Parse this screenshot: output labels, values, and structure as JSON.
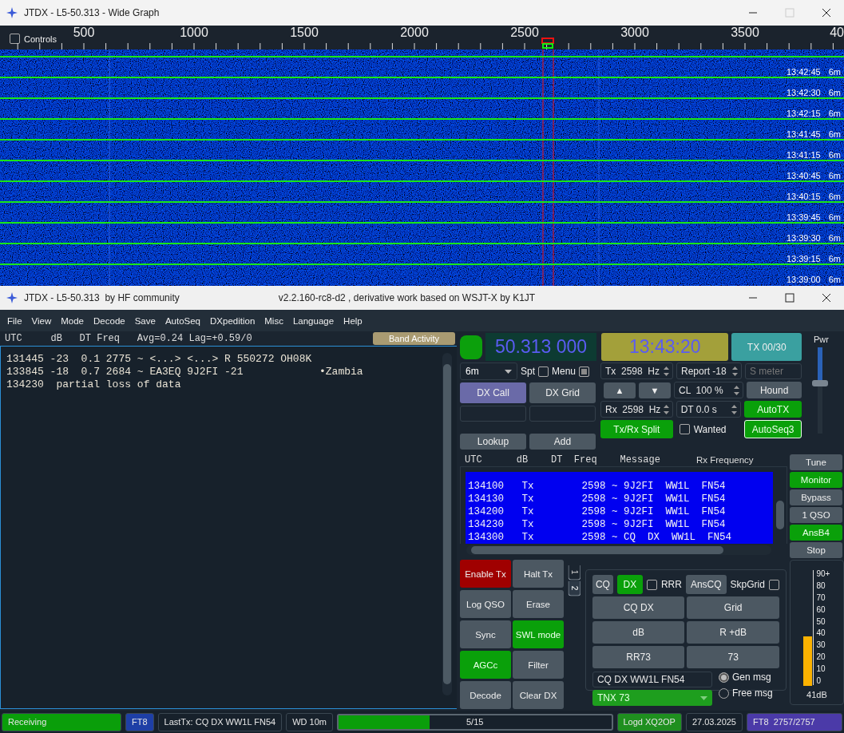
{
  "wide_graph": {
    "title": "JTDX - L5-50.313 - Wide Graph",
    "controls": {
      "label": "Controls",
      "checked": false
    },
    "scale_labels": [
      "500",
      "1000",
      "1500",
      "2000",
      "2500",
      "3000",
      "3500",
      "40"
    ],
    "waterfall_rows": [
      {
        "time": "13:42:45",
        "band": "6m"
      },
      {
        "time": "13:42:30",
        "band": "6m"
      },
      {
        "time": "13:42:15",
        "band": "6m"
      },
      {
        "time": "13:41:45",
        "band": "6m"
      },
      {
        "time": "13:41:15",
        "band": "6m"
      },
      {
        "time": "13:40:45",
        "band": "6m"
      },
      {
        "time": "13:40:15",
        "band": "6m"
      },
      {
        "time": "13:39:45",
        "band": "6m"
      },
      {
        "time": "13:39:30",
        "band": "6m"
      },
      {
        "time": "13:39:15",
        "band": "6m"
      },
      {
        "time": "13:39:00",
        "band": "6m"
      }
    ]
  },
  "main_window": {
    "title": "JTDX - L5-50.313  by HF community",
    "subtitle": "v2.2.160-rc8-d2 , derivative work based on WSJT-X by K1JT"
  },
  "menu": [
    "File",
    "View",
    "Mode",
    "Decode",
    "Save",
    "AutoSeq",
    "DXpedition",
    "Misc",
    "Language",
    "Help"
  ],
  "band_activity": {
    "header": "UTC     dB   DT Freq   Avg=0.24 Lag=+0.59/0",
    "button": "Band Activity",
    "lines": [
      {
        "text": "131445 -23  0.1 2775 ~ <...> <...> R 550272 OH08K"
      },
      {
        "text": "133845 -18  0.7 2684 ~ EA3EQ 9J2FI -21",
        "note": "•Zambia"
      },
      {
        "text": "134230  partial loss of data"
      }
    ]
  },
  "dial": {
    "led_on": true,
    "frequency": "50.313 000",
    "time": "13:43:20",
    "tx_counter": "TX 00/30",
    "band": "6m",
    "power_label": "Pwr",
    "power": {
      "level": 0.6
    }
  },
  "options": [
    {
      "label": "Spt",
      "checked": false
    },
    {
      "label": "Menu",
      "checked": true
    }
  ],
  "dx_buttons": [
    {
      "label": "DX Call",
      "selected": true
    },
    {
      "label": "DX Grid",
      "selected": false
    }
  ],
  "lookup_buttons": [
    "Lookup",
    "Add"
  ],
  "spin_boxes": [
    {
      "text": "Tx  2598  Hz"
    },
    {
      "text": "Report -18"
    },
    {
      "text": "CL  100 %"
    },
    {
      "text": "Rx  2598  Hz"
    },
    {
      "text": "DT 0.0 s"
    }
  ],
  "arrow_buttons": [
    "▲",
    "▼"
  ],
  "s_meter": {
    "placeholder": "S meter"
  },
  "split_button": {
    "label": "Tx/Rx Split",
    "on": true
  },
  "wanted": {
    "label": "Wanted",
    "checked": false
  },
  "auto_buttons": [
    {
      "label": "Hound",
      "on": false
    },
    {
      "label": "AutoTX",
      "on": true
    },
    {
      "label": "AutoSeq3",
      "on": true
    }
  ],
  "rx_frequency": {
    "header": "UTC      dB    DT  Freq    Message",
    "title": "Rx Frequency",
    "rows": [
      "134100   Tx        2598 ~ 9J2FI  WW1L  FN54",
      "134130   Tx        2598 ~ 9J2FI  WW1L  FN54",
      "134200   Tx        2598 ~ 9J2FI  WW1L  FN54",
      "134230   Tx        2598 ~ 9J2FI  WW1L  FN54",
      "134300   Tx        2598 ~ CQ  DX  WW1L  FN54"
    ]
  },
  "side_buttons": [
    {
      "label": "Tune",
      "on": false
    },
    {
      "label": "Monitor",
      "on": true
    },
    {
      "label": "Bypass",
      "on": false
    },
    {
      "label": "1 QSO",
      "on": false
    },
    {
      "label": "AnsB4",
      "on": true
    },
    {
      "label": "Stop",
      "on": false
    }
  ],
  "action_buttons": [
    {
      "label": "Enable Tx",
      "on": true,
      "kind": "tx"
    },
    {
      "label": "Halt Tx",
      "on": false
    },
    {
      "label": "Log QSO",
      "on": false
    },
    {
      "label": "Erase",
      "on": false
    },
    {
      "label": "Sync",
      "on": false
    },
    {
      "label": "SWL mode",
      "on": true
    },
    {
      "label": "AGCc",
      "on": true
    },
    {
      "label": "Filter",
      "on": false
    },
    {
      "label": "Decode",
      "on": false
    },
    {
      "label": "Clear DX",
      "on": false
    }
  ],
  "tabs": [
    {
      "label": "1",
      "selected": false
    },
    {
      "label": "2",
      "selected": true
    }
  ],
  "messages": {
    "mode_buttons": [
      {
        "label": "CQ",
        "selected": false
      },
      {
        "label": "DX",
        "selected": true
      }
    ],
    "rrr": {
      "label": "RRR",
      "checked": false
    },
    "anscq": "AnsCQ",
    "skpgrid": {
      "label": "SkpGrid",
      "checked": false
    },
    "buttons": [
      "CQ DX",
      "Grid",
      "dB",
      "R +dB",
      "RR73",
      "73"
    ],
    "gen_field": "CQ DX  WW1L FN54",
    "free_dropdown": "TNX 73",
    "radios": [
      {
        "label": "Gen msg",
        "selected": true
      },
      {
        "label": "Free msg",
        "selected": false
      }
    ]
  },
  "meter": {
    "labels": [
      "90+",
      "80",
      "70",
      "60",
      "50",
      "40",
      "30",
      "20",
      "10",
      "0"
    ],
    "level": 0.44,
    "reading": "41dB"
  },
  "status_bar": [
    {
      "kind": "label",
      "text": "Receiving",
      "color": "#0a9e0a"
    },
    {
      "kind": "label",
      "text": "FT8",
      "color": "#1e3fa6"
    },
    {
      "kind": "label",
      "text": "LastTx: CQ DX WW1L FN54"
    },
    {
      "kind": "label",
      "text": "WD 10m"
    },
    {
      "kind": "progress",
      "text": "5/15",
      "level": 0.333
    },
    {
      "kind": "label",
      "text": "Logd XQ2OP",
      "color": "#1f8f1f"
    },
    {
      "kind": "label",
      "text": "27.03.2025"
    },
    {
      "kind": "label",
      "text": "FT8  2757/2757",
      "color": "#4b3aa8"
    }
  ]
}
